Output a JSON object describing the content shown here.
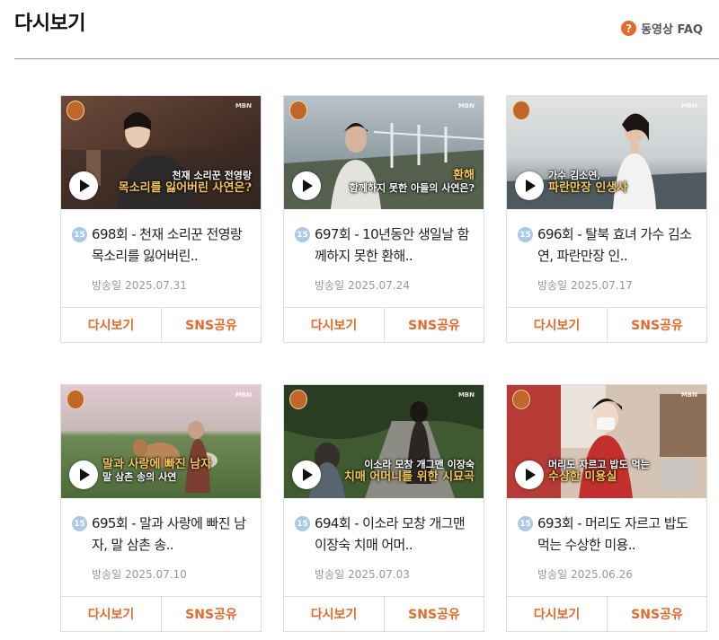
{
  "page": {
    "title": "다시보기",
    "faq_label": "동영상 FAQ",
    "faq_icon": "question-circle-icon"
  },
  "labels": {
    "replay": "다시보기",
    "share": "SNS공유",
    "air_date_label": "방송일",
    "rating": "15"
  },
  "colors": {
    "accent": "#e8692a",
    "rating_badge": "#a9c9e6"
  },
  "episodes": [
    {
      "title": "698회 - 천재 소리꾼 전영랑 목소리를 잃어버린..",
      "date": "2025.07.31",
      "caption_top": "천재 소리꾼 전영랑",
      "caption_bottom": "목소리를 잃어버린 사연은?"
    },
    {
      "title": "697회 - 10년동안 생일날 함께하지 못한 환해..",
      "date": "2025.07.24",
      "caption_top": "환해",
      "caption_bottom": "함께하지 못한 아들의 사연은?"
    },
    {
      "title": "696회 - 탈북 효녀 가수 김소연, 파란만장 인..",
      "date": "2025.07.17",
      "caption_top": "가수 김소연,",
      "caption_bottom": "파란만장 인생사"
    },
    {
      "title": "695회 - 말과 사랑에 빠진 남자, 말 삼촌 송..",
      "date": "2025.07.10",
      "caption_top": "말과 사랑에 빠진 남자",
      "caption_bottom": "말 삼촌 송의 사연"
    },
    {
      "title": "694회 - 이소라 모창 개그맨 이장숙 치매 어머..",
      "date": "2025.07.03",
      "caption_top": "이소라 모창 개그맨 이장숙",
      "caption_bottom": "치매 어머니를 위한 시묘곡"
    },
    {
      "title": "693회 - 머리도 자르고 밥도 먹는 수상한 미용..",
      "date": "2025.06.26",
      "caption_top": "머리도 자르고 밥도 먹는",
      "caption_bottom": "수상한 미용실"
    }
  ]
}
